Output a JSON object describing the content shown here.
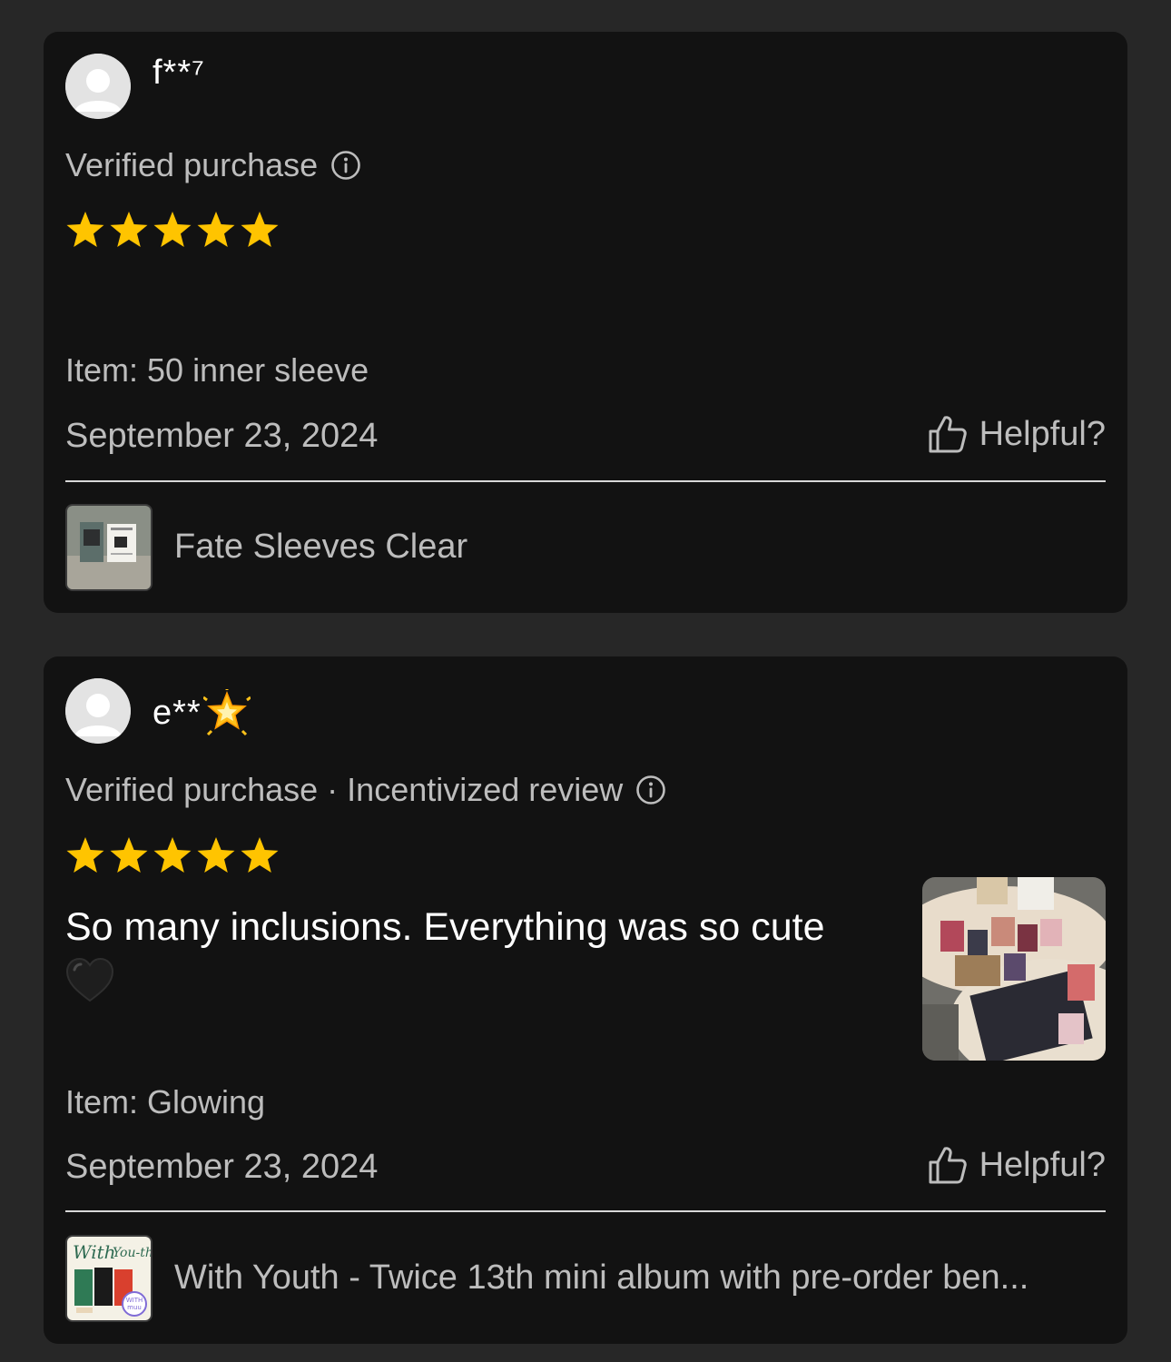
{
  "reviews": [
    {
      "username": "f**⁷",
      "verified_label": "Verified purchase",
      "rating": 5,
      "item": "Item: 50 inner sleeve",
      "date": "September 23, 2024",
      "helpful_label": "Helpful?",
      "product_name": "Fate Sleeves Clear",
      "product_thumb_icon": "product-thumbnail"
    },
    {
      "username": "e**",
      "username_emoji": "glowing-star",
      "verified_label": "Verified purchase · Incentivized review",
      "rating": 5,
      "review_text": "So many inclusions. Everything was so cute",
      "review_emoji": "black-heart",
      "item": "Item: Glowing",
      "date": "September 23, 2024",
      "helpful_label": "Helpful?",
      "product_name": "With Youth - Twice 13th mini album with pre-order ben...",
      "product_thumb_icon": "product-thumbnail",
      "photo": "review-photo"
    }
  ],
  "colors": {
    "page_bg": "#272727",
    "card_bg": "#121212",
    "star": "#FFC400",
    "muted_text": "#BDBDBD",
    "text": "#FFFFFF"
  }
}
